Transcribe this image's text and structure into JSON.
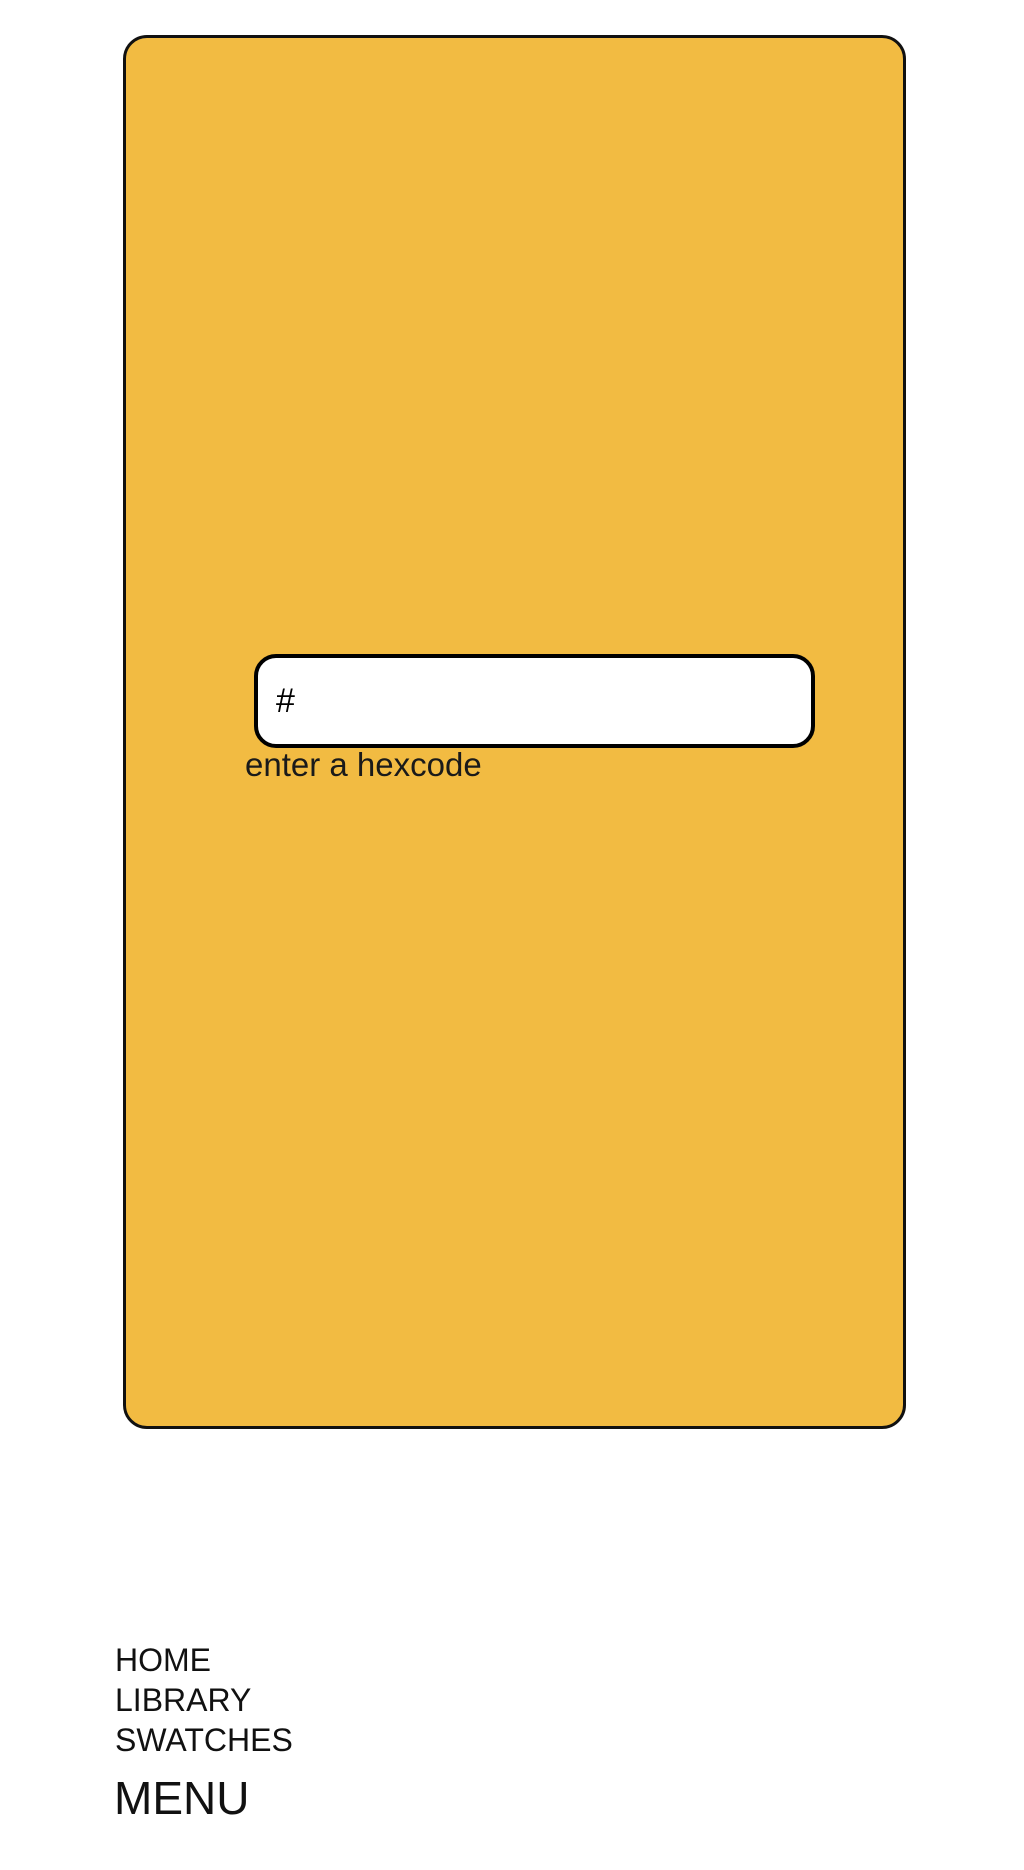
{
  "swatch": {
    "color": "#F2BB42",
    "hash_prefix": "#",
    "input_value": "",
    "hint": "enter a hexcode"
  },
  "nav": {
    "items": [
      {
        "label": "HOME"
      },
      {
        "label": "LIBRARY"
      },
      {
        "label": "SWATCHES"
      }
    ],
    "menu_label": "MENU"
  }
}
